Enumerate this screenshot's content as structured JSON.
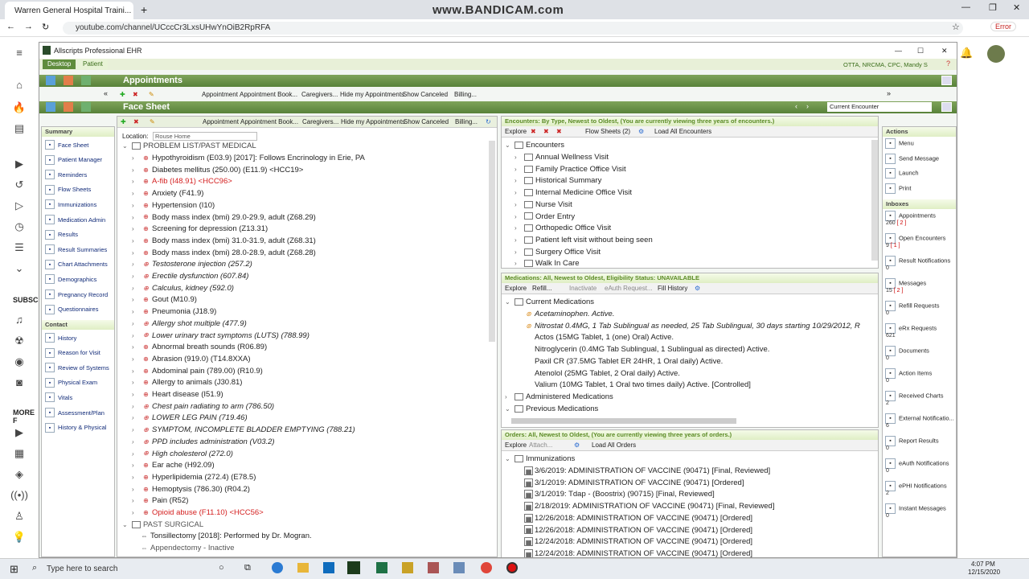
{
  "browser": {
    "tab_title": "Warren General Hospital Traini...",
    "url": "youtube.com/channel/UCccCr3LxsUHwYnOiB2RpRFA",
    "error_label": "Error",
    "watermark": "www.BANDICAM.com"
  },
  "youtube": {
    "subscriptions_label": "SUBSCR",
    "more_label": "MORE F"
  },
  "ehr": {
    "app_title": "Allscripts Professional EHR",
    "top_tabs": [
      "Desktop",
      "Patient"
    ],
    "user_label": "OTTA, NRCMA, CPC, Mandy S",
    "appointments_title": "Appointments",
    "face_sheet_title": "Face Sheet",
    "toolbar_items": [
      "Appointment",
      "Appointment Book...",
      "Caregivers...",
      "Hide my Appointments",
      "Show Canceled",
      "Billing..."
    ],
    "encounter_select": "Current Encounter",
    "location_label": "Location:",
    "location_value": "Rouse Home",
    "summary_header": "Summary",
    "summary_items": [
      "Face Sheet",
      "Patient Manager",
      "Reminders",
      "Flow Sheets",
      "Immunizations",
      "Medication Admin",
      "Results",
      "Result Summaries",
      "Chart Attachments",
      "Demographics",
      "Pregnancy Record",
      "Questionnaires"
    ],
    "contact_header": "Contact",
    "contact_items": [
      "History",
      "Reason for Visit",
      "Review of Systems",
      "Physical Exam",
      "Vitals",
      "Assessment/Plan",
      "History & Physical"
    ],
    "problem_header": "PROBLEM LIST/PAST MEDICAL",
    "problems": [
      {
        "text": "Hypothyroidism (E03.9) [2017]: Follows Encrinology in Erie, PA",
        "style": "normal"
      },
      {
        "text": "Diabetes mellitus (250.00) (E11.9) <HCC19>",
        "style": "normal"
      },
      {
        "text": "A-fib (I48.91) <HCC96>",
        "style": "red"
      },
      {
        "text": "Anxiety (F41.9)",
        "style": "normal"
      },
      {
        "text": "Hypertension (I10)",
        "style": "normal"
      },
      {
        "text": "Body mass index (bmi) 29.0-29.9, adult (Z68.29)",
        "style": "normal"
      },
      {
        "text": "Screening for depression  (Z13.31)",
        "style": "normal"
      },
      {
        "text": "Body mass index (bmi) 31.0-31.9, adult (Z68.31)",
        "style": "normal"
      },
      {
        "text": "Body mass index (bmi) 28.0-28.9, adult (Z68.28)",
        "style": "normal"
      },
      {
        "text": "Testosterone injection  (257.2)",
        "style": "italic"
      },
      {
        "text": "Erectile dysfunction (607.84)",
        "style": "italic"
      },
      {
        "text": "Calculus, kidney (592.0)",
        "style": "italic"
      },
      {
        "text": "Gout (M10.9)",
        "style": "normal"
      },
      {
        "text": "Pneumonia (J18.9)",
        "style": "normal"
      },
      {
        "text": "Allergy shot multiple  (477.9)",
        "style": "italic"
      },
      {
        "text": "Lower urinary tract symptoms (LUTS) (788.99)",
        "style": "italic"
      },
      {
        "text": "Abnormal breath sounds (R06.89)",
        "style": "normal"
      },
      {
        "text": "Abrasion (919.0) (T14.8XXA)",
        "style": "normal"
      },
      {
        "text": "Abdominal pain (789.00) (R10.9)",
        "style": "normal"
      },
      {
        "text": "Allergy to animals (J30.81)",
        "style": "normal"
      },
      {
        "text": "Heart disease (I51.9)",
        "style": "normal"
      },
      {
        "text": "Chest pain radiating to arm (786.50)",
        "style": "italic"
      },
      {
        "text": "LOWER LEG PAIN (719.46)",
        "style": "italic"
      },
      {
        "text": "SYMPTOM, INCOMPLETE BLADDER EMPTYING (788.21)",
        "style": "italic"
      },
      {
        "text": "PPD includes administration (V03.2)",
        "style": "italic"
      },
      {
        "text": "High cholesterol (272.0)",
        "style": "italic"
      },
      {
        "text": "Ear ache (H92.09)",
        "style": "normal"
      },
      {
        "text": "Hyperlipidemia (272.4) (E78.5)",
        "style": "normal"
      },
      {
        "text": "Hemoptysis (786.30) (R04.2)",
        "style": "normal"
      },
      {
        "text": "Pain (R52)",
        "style": "normal"
      },
      {
        "text": "Opioid abuse (F11.10) <HCC56>",
        "style": "red"
      }
    ],
    "surgical_header": "PAST SURGICAL",
    "surgical": [
      {
        "text": "Tonsillectomy [2018]: Performed by Dr. Mogran.",
        "style": "normal"
      },
      {
        "text": "Appendectomy - Inactive",
        "style": "grey"
      }
    ],
    "encounters": {
      "header": "Encounters: By Type, Newest to Oldest, (You are currently viewing three years of encounters.)",
      "toolbar": [
        "Explore",
        "Flow Sheets (2)",
        "Load All Encounters"
      ],
      "root": "Encounters",
      "items": [
        "Annual Wellness Visit",
        "Family Practice Office Visit",
        "Historical Summary",
        "Internal Medicine Office Visit",
        "Nurse Visit",
        "Order Entry",
        "Orthopedic Office Visit",
        "Patient left visit without being seen",
        "Surgery Office Visit",
        "Walk In Care"
      ]
    },
    "medications": {
      "header": "Medications: All, Newest to Oldest, Eligibility Status: UNAVAILABLE",
      "toolbar": [
        "Explore",
        "Refill...",
        "Inactivate",
        "eAuth Request...",
        "Fill History"
      ],
      "current": "Current Medications",
      "items": [
        {
          "text": "Acetaminophen. Active.",
          "style": "italic"
        },
        {
          "text": "Nitrostat 0.4MG, 1 Tab Sublingual as needed, 25 Tab Sublingual, 30 days starting 10/29/2012, R",
          "style": "italic"
        },
        {
          "text": "Actos (15MG Tablet, 1 (one) Oral) Active.",
          "style": "normal"
        },
        {
          "text": "Nitroglycerin (0.4MG Tab Sublingual, 1 Sublingual as directed) Active.",
          "style": "normal"
        },
        {
          "text": "Paxil CR (37.5MG Tablet ER 24HR, 1 Oral daily) Active.",
          "style": "normal"
        },
        {
          "text": "Atenolol (25MG Tablet, 2 Oral daily) Active.",
          "style": "normal"
        },
        {
          "text": "Valium (10MG Tablet, 1 Oral two times daily) Active. [Controlled]",
          "style": "normal"
        }
      ],
      "administered": "Administered Medications",
      "previous": "Previous Medications"
    },
    "orders": {
      "header": "Orders: All, Newest to Oldest, (You are currently viewing three years of orders.)",
      "toolbar": [
        "Explore",
        "Attach...",
        "Load All Orders"
      ],
      "group": "Immunizations",
      "items": [
        "3/6/2019: ADMINISTRATION OF VACCINE (90471) [Final, Reviewed]",
        "3/1/2019: ADMINISTRATION OF VACCINE (90471) [Ordered]",
        "3/1/2019: Tdap - (Boostrix) (90715) [Final, Reviewed]",
        "2/18/2019: ADMINISTRATION OF VACCINE (90471) [Final, Reviewed]",
        "12/26/2018: ADMINISTRATION OF VACCINE (90471) [Ordered]",
        "12/26/2018: ADMINISTRATION OF VACCINE (90471) [Ordered]",
        "12/24/2018: ADMINISTRATION OF VACCINE (90471) [Ordered]",
        "12/24/2018: ADMINISTRATION OF VACCINE (90471) [Ordered]"
      ]
    },
    "actions_header": "Actions",
    "actions": [
      "Menu",
      "Send Message",
      "Launch",
      "Print"
    ],
    "inboxes_header": "Inboxes",
    "inboxes": [
      {
        "label": "Appointments",
        "count": "260",
        "extra": "[ 2 ]"
      },
      {
        "label": "Open Encounters",
        "count": "9",
        "extra": "[ 1 ]"
      },
      {
        "label": "Result Notifications",
        "count": "0",
        "extra": ""
      },
      {
        "label": "Messages",
        "count": "15",
        "extra": "[ 2 ]"
      },
      {
        "label": "Refill Requests",
        "count": "0",
        "extra": ""
      },
      {
        "label": "eRx Requests",
        "count": "621",
        "extra": ""
      },
      {
        "label": "Documents",
        "count": "0",
        "extra": ""
      },
      {
        "label": "Action Items",
        "count": "0",
        "extra": ""
      },
      {
        "label": "Received Charts",
        "count": "2",
        "extra": ""
      },
      {
        "label": "External Notificatio...",
        "count": "6",
        "extra": ""
      },
      {
        "label": "Report Results",
        "count": "0",
        "extra": ""
      },
      {
        "label": "eAuth Notifications",
        "count": "0",
        "extra": ""
      },
      {
        "label": "ePHI Notifications",
        "count": "2",
        "extra": ""
      },
      {
        "label": "Instant Messages",
        "count": "0",
        "extra": ""
      }
    ]
  },
  "taskbar": {
    "search_placeholder": "Type here to search",
    "time": "4:07 PM",
    "date": "12/15/2020"
  }
}
